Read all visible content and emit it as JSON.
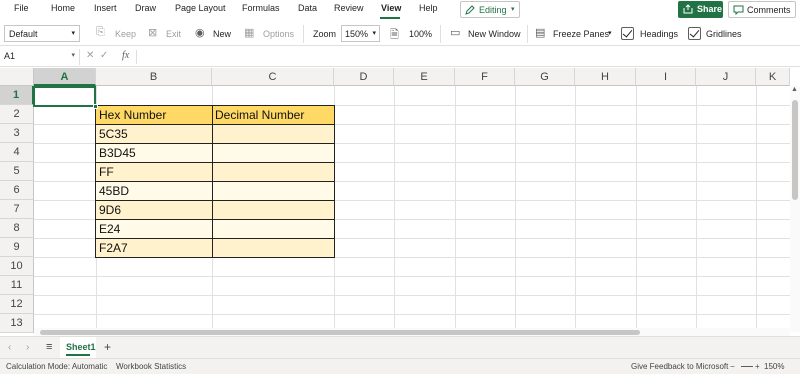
{
  "menu": [
    "File",
    "Home",
    "Insert",
    "Draw",
    "Page Layout",
    "Formulas",
    "Data",
    "Review",
    "View",
    "Help"
  ],
  "menu_active": "View",
  "editing_label": "Editing",
  "share_label": "Share",
  "comments_label": "Comments",
  "toolbar": {
    "style_value": "Default",
    "keep": "Keep",
    "exit": "Exit",
    "new": "New",
    "options": "Options",
    "zoom_label": "Zoom",
    "zoom_value": "150%",
    "hundred": "100%",
    "new_window": "New Window",
    "freeze_panes": "Freeze Panes",
    "headings": "Headings",
    "gridlines": "Gridlines"
  },
  "formula_bar": {
    "name_box": "A1",
    "fx": "fx",
    "value": ""
  },
  "columns": [
    "A",
    "B",
    "C",
    "D",
    "E",
    "F",
    "G",
    "H",
    "I",
    "J",
    "K"
  ],
  "rows": [
    "1",
    "2",
    "3",
    "4",
    "5",
    "6",
    "7",
    "8",
    "9",
    "10",
    "11",
    "12",
    "13"
  ],
  "selected_cell": "A1",
  "table": {
    "headers": [
      "Hex Number",
      "Decimal Number"
    ],
    "hex_values": [
      "5C35",
      "B3D45",
      "FF",
      "45BD",
      "9D6",
      "E24",
      "F2A7"
    ],
    "decimal_values": [
      "",
      "",
      "",
      "",
      "",
      "",
      ""
    ],
    "header_color": "#ffd966",
    "odd_row_color": "#fff2cc",
    "even_row_color": "#fffbe8"
  },
  "sheet_tab": "Sheet1",
  "status": {
    "calc_mode": "Calculation Mode: Automatic",
    "workbook_stats": "Workbook Statistics",
    "feedback": "Give Feedback to Microsoft",
    "zoom": "150%"
  },
  "colors": {
    "accent": "#217346"
  }
}
